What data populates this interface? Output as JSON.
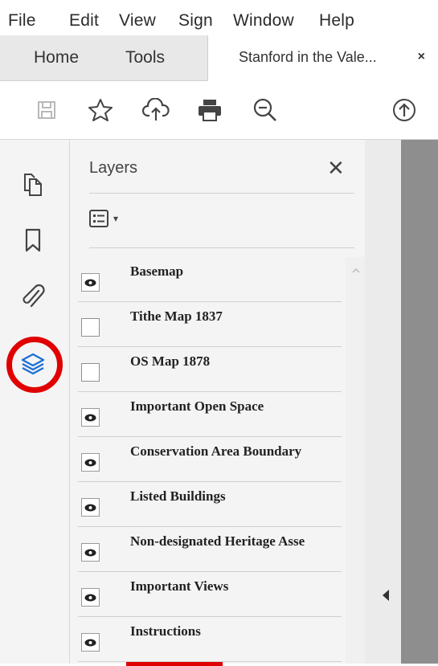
{
  "menu": [
    "File",
    "Edit",
    "View",
    "Sign",
    "Window",
    "Help"
  ],
  "tabs": {
    "home_label": "Home",
    "tools_label": "Tools",
    "document_label": "Stanford in the Vale...",
    "close_glyph": "×"
  },
  "toolbar": {
    "icons": [
      "save-icon",
      "star-icon",
      "upload-cloud-icon",
      "print-icon",
      "zoom-out-icon",
      "arrow-up-circle-icon"
    ]
  },
  "left_rail": {
    "icons": [
      "pages-icon",
      "bookmark-icon",
      "attachment-icon",
      "layers-icon"
    ]
  },
  "panel": {
    "title": "Layers",
    "close_glyph": "✕",
    "options_caret": "▾",
    "layers": [
      {
        "label": "Basemap",
        "visible": true
      },
      {
        "label": "Tithe Map 1837",
        "visible": false
      },
      {
        "label": "OS Map 1878",
        "visible": false
      },
      {
        "label": "Important Open Space",
        "visible": true
      },
      {
        "label": "Conservation Area Boundary",
        "visible": true
      },
      {
        "label": "Listed Buildings",
        "visible": true
      },
      {
        "label": "Non-designated Heritage Asse",
        "visible": true
      },
      {
        "label": "Important Views",
        "visible": true
      },
      {
        "label": "Instructions",
        "visible": true
      }
    ]
  },
  "colors": {
    "accent": "#1d6fd6",
    "highlight": "#e00000"
  }
}
